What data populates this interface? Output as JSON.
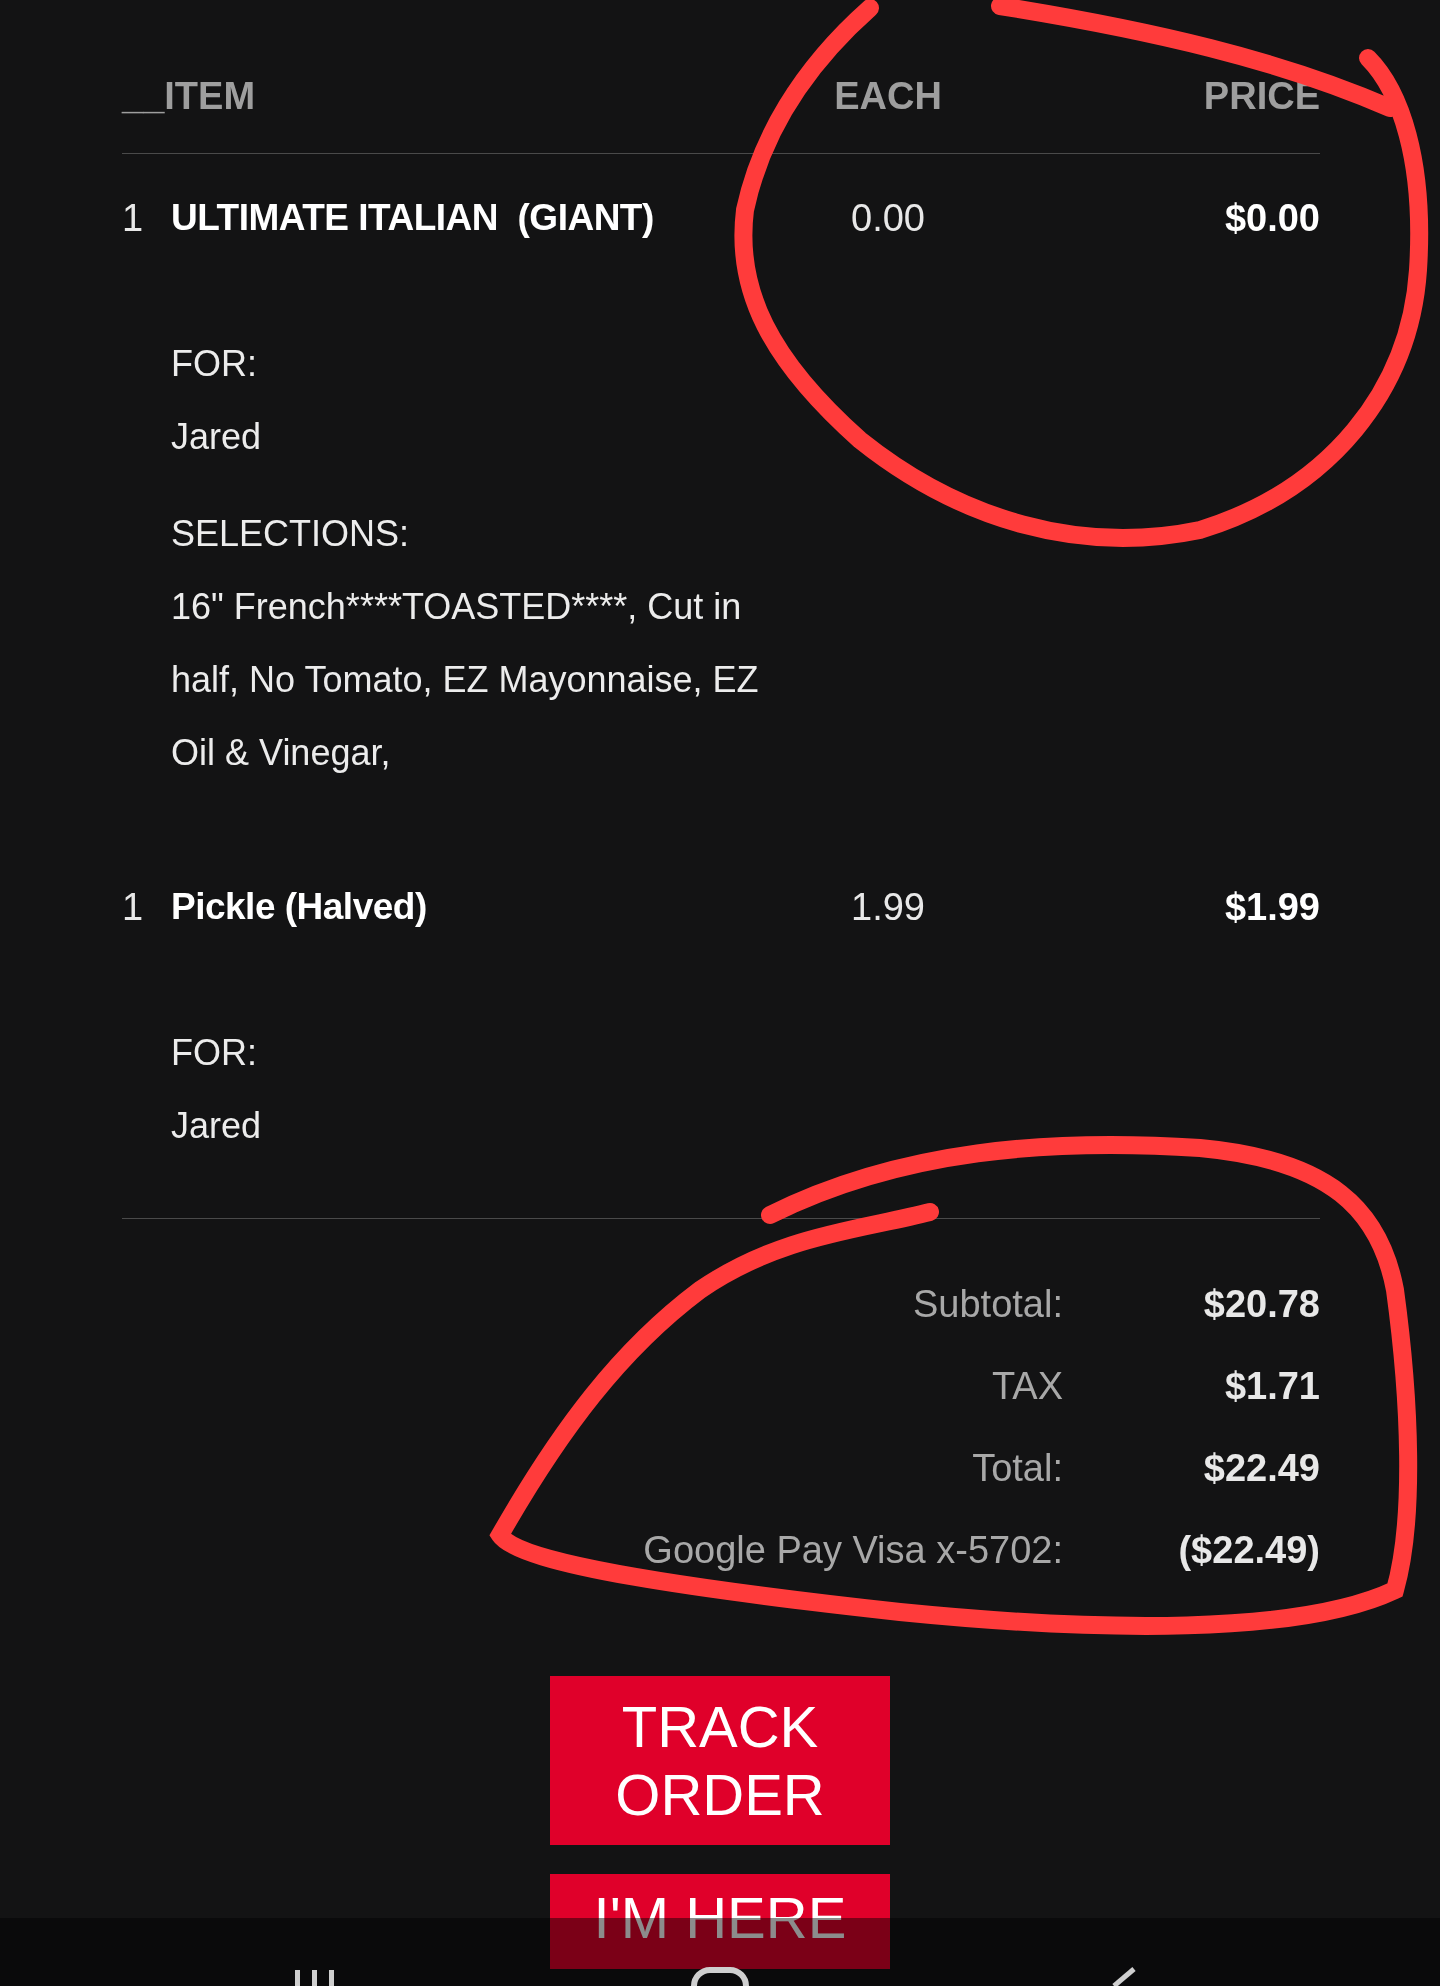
{
  "header": {
    "columns": [
      "__ITEM",
      "EACH",
      "PRICE"
    ]
  },
  "items": [
    {
      "qty": "1",
      "name": "ULTIMATE ITALIAN  (GIANT)",
      "each": "0.00",
      "price": "$0.00",
      "details": [
        {
          "label": "FOR:",
          "value": "Jared"
        },
        {
          "label": "SELECTIONS:",
          "value": "16\" French****TOASTED****, Cut in half, No Tomato, EZ Mayonnaise, EZ Oil & Vinegar,"
        }
      ]
    },
    {
      "qty": "1",
      "name": "Pickle (Halved)",
      "each": "1.99",
      "price": "$1.99",
      "details": [
        {
          "label": "FOR:",
          "value": "Jared"
        }
      ]
    }
  ],
  "summary": [
    {
      "label": "Subtotal:",
      "value": "$20.78"
    },
    {
      "label": "TAX",
      "value": "$1.71"
    },
    {
      "label": "Total:",
      "value": "$22.49"
    },
    {
      "label": "Google Pay Visa x-5702:",
      "value": "($22.49)"
    }
  ],
  "buttons": [
    "TRACK ORDER",
    "I'M HERE"
  ]
}
